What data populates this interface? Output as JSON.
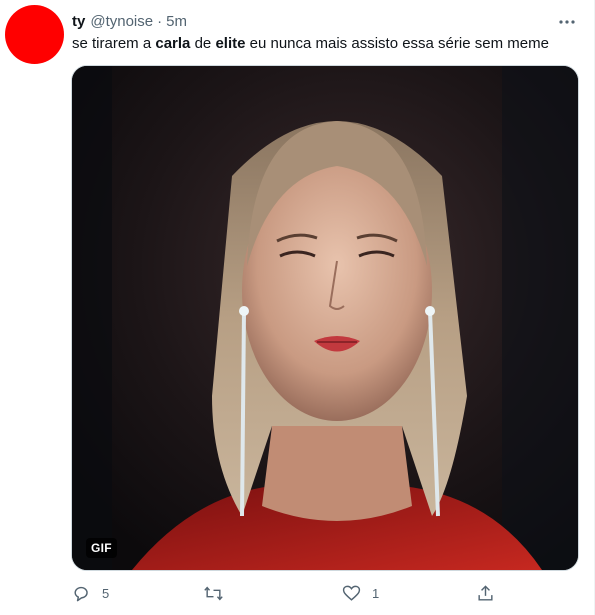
{
  "tweet": {
    "display_name": "ty",
    "handle": "@tynoise",
    "separator": "·",
    "time": "5m",
    "text_parts": {
      "p1": "se tirarem a ",
      "b1": "carla",
      "p2": " de ",
      "b2": "elite",
      "p3": " eu nunca mais assisto essa série sem meme"
    },
    "media": {
      "badge": "GIF"
    },
    "actions": {
      "reply_count": "5",
      "retweet_count": "",
      "like_count": "1"
    }
  },
  "colors": {
    "avatar": "#ff0000",
    "text": "#0f1419",
    "secondary": "#536471"
  }
}
